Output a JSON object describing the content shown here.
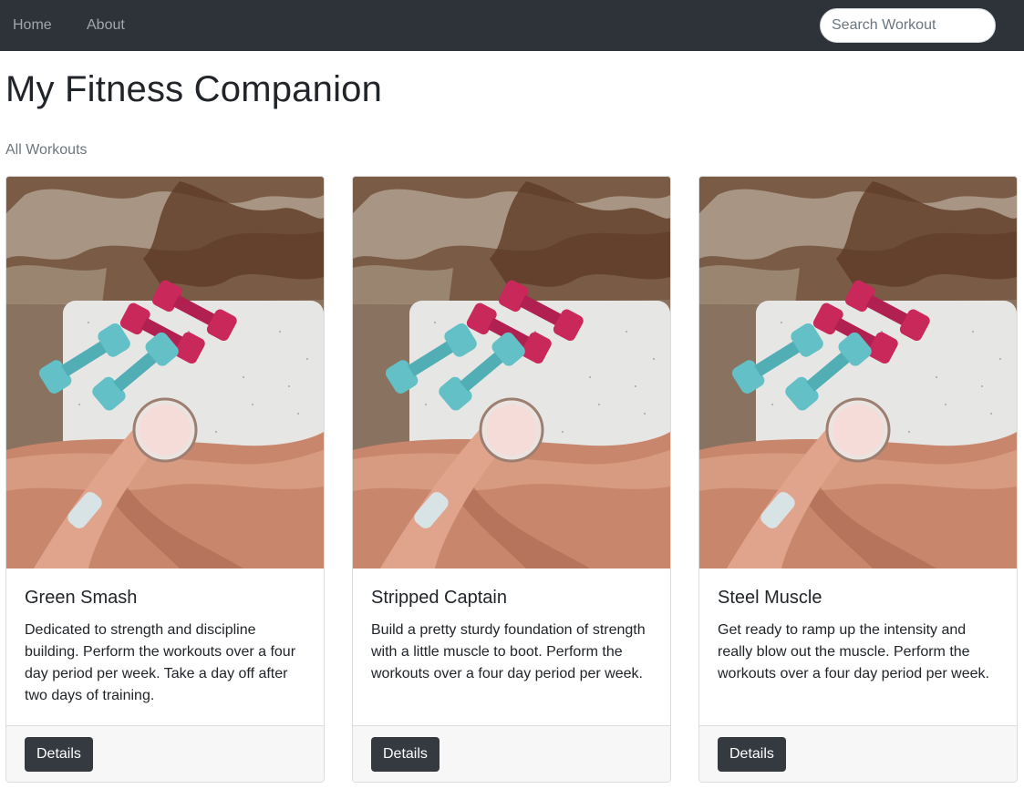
{
  "nav": {
    "home_label": "Home",
    "about_label": "About",
    "search_placeholder": "Search Workout"
  },
  "page": {
    "title": "My Fitness Companion",
    "section_label": "All Workouts"
  },
  "workouts": [
    {
      "title": "Green Smash",
      "description": "Dedicated to strength and discipline building. Perform the workouts over a four day period per week. Take a day off after two days of training.",
      "button_label": "Details"
    },
    {
      "title": "Stripped Captain",
      "description": "Build a pretty sturdy foundation of strength with a little muscle to boot. Perform the workouts over a four day period per week.",
      "button_label": "Details"
    },
    {
      "title": "Steel Muscle",
      "description": "Get ready to ramp up the intensity and really blow out the muscle. Perform the workouts over a four day period per week.",
      "button_label": "Details"
    }
  ],
  "colors": {
    "navbar": "#2e333a",
    "button": "#343a40",
    "footer": "#f7f7f7",
    "dumbbell_pink": "#c8285a",
    "dumbbell_teal": "#62c0c6"
  }
}
